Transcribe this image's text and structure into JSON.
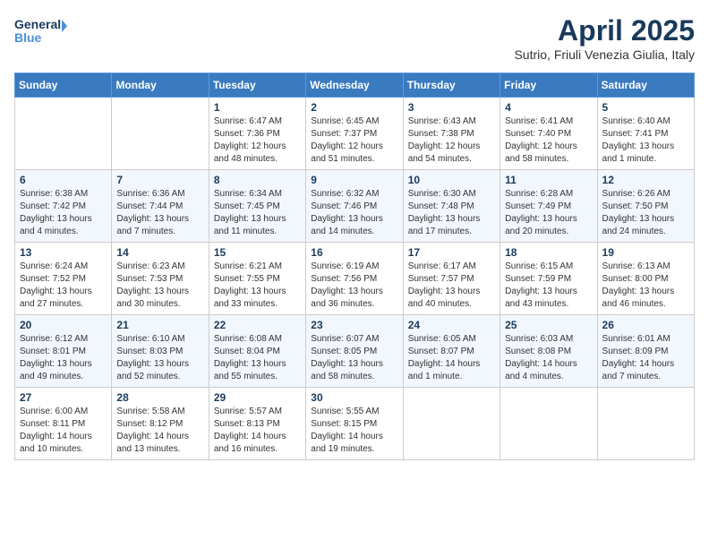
{
  "header": {
    "logo_line1": "General",
    "logo_line2": "Blue",
    "month_title": "April 2025",
    "subtitle": "Sutrio, Friuli Venezia Giulia, Italy"
  },
  "days_of_week": [
    "Sunday",
    "Monday",
    "Tuesday",
    "Wednesday",
    "Thursday",
    "Friday",
    "Saturday"
  ],
  "weeks": [
    [
      {
        "day": "",
        "info": ""
      },
      {
        "day": "",
        "info": ""
      },
      {
        "day": "1",
        "info": "Sunrise: 6:47 AM\nSunset: 7:36 PM\nDaylight: 12 hours and 48 minutes."
      },
      {
        "day": "2",
        "info": "Sunrise: 6:45 AM\nSunset: 7:37 PM\nDaylight: 12 hours and 51 minutes."
      },
      {
        "day": "3",
        "info": "Sunrise: 6:43 AM\nSunset: 7:38 PM\nDaylight: 12 hours and 54 minutes."
      },
      {
        "day": "4",
        "info": "Sunrise: 6:41 AM\nSunset: 7:40 PM\nDaylight: 12 hours and 58 minutes."
      },
      {
        "day": "5",
        "info": "Sunrise: 6:40 AM\nSunset: 7:41 PM\nDaylight: 13 hours and 1 minute."
      }
    ],
    [
      {
        "day": "6",
        "info": "Sunrise: 6:38 AM\nSunset: 7:42 PM\nDaylight: 13 hours and 4 minutes."
      },
      {
        "day": "7",
        "info": "Sunrise: 6:36 AM\nSunset: 7:44 PM\nDaylight: 13 hours and 7 minutes."
      },
      {
        "day": "8",
        "info": "Sunrise: 6:34 AM\nSunset: 7:45 PM\nDaylight: 13 hours and 11 minutes."
      },
      {
        "day": "9",
        "info": "Sunrise: 6:32 AM\nSunset: 7:46 PM\nDaylight: 13 hours and 14 minutes."
      },
      {
        "day": "10",
        "info": "Sunrise: 6:30 AM\nSunset: 7:48 PM\nDaylight: 13 hours and 17 minutes."
      },
      {
        "day": "11",
        "info": "Sunrise: 6:28 AM\nSunset: 7:49 PM\nDaylight: 13 hours and 20 minutes."
      },
      {
        "day": "12",
        "info": "Sunrise: 6:26 AM\nSunset: 7:50 PM\nDaylight: 13 hours and 24 minutes."
      }
    ],
    [
      {
        "day": "13",
        "info": "Sunrise: 6:24 AM\nSunset: 7:52 PM\nDaylight: 13 hours and 27 minutes."
      },
      {
        "day": "14",
        "info": "Sunrise: 6:23 AM\nSunset: 7:53 PM\nDaylight: 13 hours and 30 minutes."
      },
      {
        "day": "15",
        "info": "Sunrise: 6:21 AM\nSunset: 7:55 PM\nDaylight: 13 hours and 33 minutes."
      },
      {
        "day": "16",
        "info": "Sunrise: 6:19 AM\nSunset: 7:56 PM\nDaylight: 13 hours and 36 minutes."
      },
      {
        "day": "17",
        "info": "Sunrise: 6:17 AM\nSunset: 7:57 PM\nDaylight: 13 hours and 40 minutes."
      },
      {
        "day": "18",
        "info": "Sunrise: 6:15 AM\nSunset: 7:59 PM\nDaylight: 13 hours and 43 minutes."
      },
      {
        "day": "19",
        "info": "Sunrise: 6:13 AM\nSunset: 8:00 PM\nDaylight: 13 hours and 46 minutes."
      }
    ],
    [
      {
        "day": "20",
        "info": "Sunrise: 6:12 AM\nSunset: 8:01 PM\nDaylight: 13 hours and 49 minutes."
      },
      {
        "day": "21",
        "info": "Sunrise: 6:10 AM\nSunset: 8:03 PM\nDaylight: 13 hours and 52 minutes."
      },
      {
        "day": "22",
        "info": "Sunrise: 6:08 AM\nSunset: 8:04 PM\nDaylight: 13 hours and 55 minutes."
      },
      {
        "day": "23",
        "info": "Sunrise: 6:07 AM\nSunset: 8:05 PM\nDaylight: 13 hours and 58 minutes."
      },
      {
        "day": "24",
        "info": "Sunrise: 6:05 AM\nSunset: 8:07 PM\nDaylight: 14 hours and 1 minute."
      },
      {
        "day": "25",
        "info": "Sunrise: 6:03 AM\nSunset: 8:08 PM\nDaylight: 14 hours and 4 minutes."
      },
      {
        "day": "26",
        "info": "Sunrise: 6:01 AM\nSunset: 8:09 PM\nDaylight: 14 hours and 7 minutes."
      }
    ],
    [
      {
        "day": "27",
        "info": "Sunrise: 6:00 AM\nSunset: 8:11 PM\nDaylight: 14 hours and 10 minutes."
      },
      {
        "day": "28",
        "info": "Sunrise: 5:58 AM\nSunset: 8:12 PM\nDaylight: 14 hours and 13 minutes."
      },
      {
        "day": "29",
        "info": "Sunrise: 5:57 AM\nSunset: 8:13 PM\nDaylight: 14 hours and 16 minutes."
      },
      {
        "day": "30",
        "info": "Sunrise: 5:55 AM\nSunset: 8:15 PM\nDaylight: 14 hours and 19 minutes."
      },
      {
        "day": "",
        "info": ""
      },
      {
        "day": "",
        "info": ""
      },
      {
        "day": "",
        "info": ""
      }
    ]
  ]
}
